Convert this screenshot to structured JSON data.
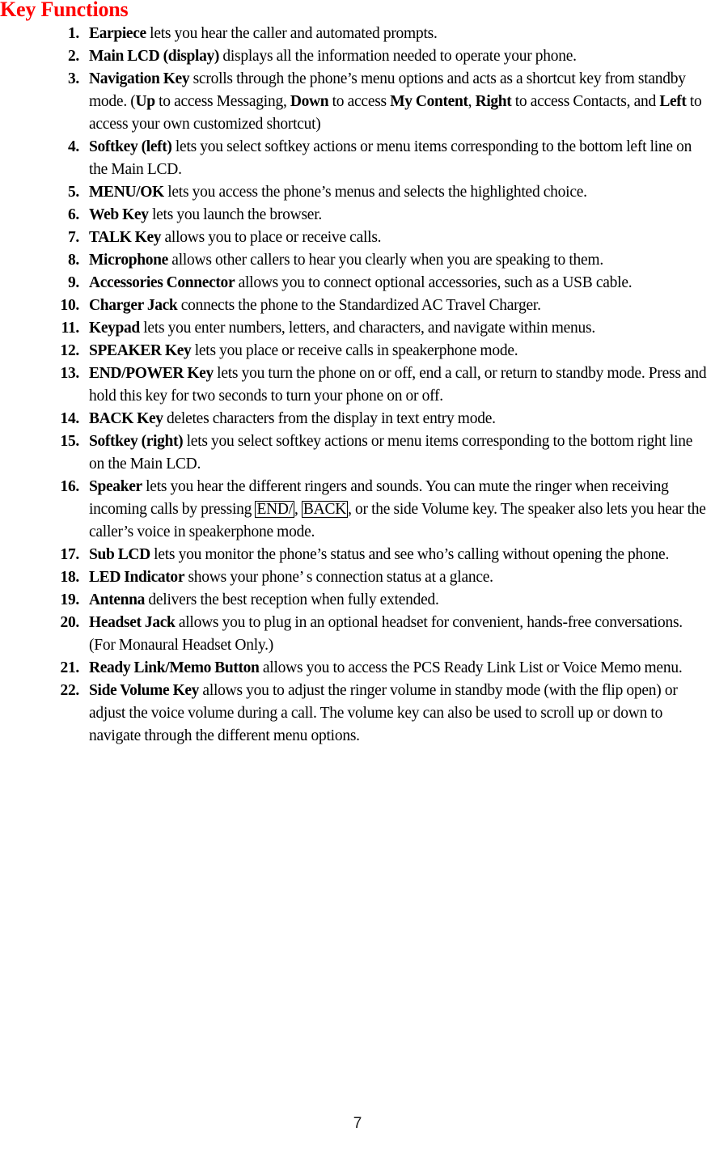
{
  "document": {
    "title": "Key Functions",
    "title_color": "#FF0000",
    "page_number": "7"
  },
  "items": [
    {
      "number": "1.",
      "term": "Earpiece",
      "text": " lets you hear the caller and automated prompts."
    },
    {
      "number": "2.",
      "term": "Main LCD (display)",
      "text": " displays all the information needed to operate your phone."
    },
    {
      "number": "3.",
      "term": "Navigation Key",
      "text": " scrolls through the phone’s menu options and acts as a shortcut key from standby mode. (",
      "runs": [
        {
          "style": "bold",
          "text": "Up"
        },
        {
          "style": "normal",
          "text": " to access Messaging, "
        },
        {
          "style": "bold",
          "text": "Down"
        },
        {
          "style": "normal",
          "text": " to access "
        },
        {
          "style": "bold",
          "text": "My Content"
        },
        {
          "style": "normal",
          "text": ", "
        },
        {
          "style": "bold",
          "text": "Right"
        },
        {
          "style": "normal",
          "text": " to access Contacts, and "
        },
        {
          "style": "bold",
          "text": "Left"
        },
        {
          "style": "normal",
          "text": " to access your own customized shortcut)"
        }
      ]
    },
    {
      "number": "4.",
      "term": "Softkey (left)",
      "text": " lets you select softkey actions or menu items corresponding to the bottom left line on the Main LCD."
    },
    {
      "number": "5.",
      "term": "MENU/OK",
      "text": " lets you access the phone’s menus and selects the highlighted choice."
    },
    {
      "number": "6.",
      "term": "Web Key",
      "text": " lets you launch the browser."
    },
    {
      "number": "7.",
      "term": "TALK Key",
      "text": " allows you to place or receive calls."
    },
    {
      "number": "8.",
      "term": "Microphone",
      "text": " allows other callers to hear you clearly when you are speaking to them."
    },
    {
      "number": "9.",
      "term": "Accessories Connector",
      "text": " allows you to connect optional accessories, such as a USB cable."
    },
    {
      "number": "10.",
      "term": "Charger Jack",
      "text": " connects the phone to the Standardized AC Travel Charger."
    },
    {
      "number": "11.",
      "term": "Keypad",
      "text": " lets you enter numbers, letters, and characters, and navigate within menus."
    },
    {
      "number": "12.",
      "term": "SPEAKER Key",
      "text": " lets you place or receive calls in speakerphone mode."
    },
    {
      "number": "13.",
      "term": "END/POWER Key",
      "text": " lets you turn the phone on or off, end a call, or return to standby mode. Press and hold this key for two seconds to turn your phone on or off."
    },
    {
      "number": "14.",
      "term": "BACK Key",
      "text": " deletes characters from the display in text entry mode."
    },
    {
      "number": "15.",
      "term": "Softkey (right)",
      "text": " lets you select softkey actions or menu items corresponding to the bottom right line on the Main LCD."
    },
    {
      "number": "16.",
      "term": "Speaker",
      "text": " lets you hear the different ringers and sounds. You can mute the ringer when receiving incoming calls by pressing ",
      "runs": [
        {
          "style": "box",
          "text": "END/"
        },
        {
          "style": "normal",
          "text": ", "
        },
        {
          "style": "box",
          "text": "BACK"
        },
        {
          "style": "normal",
          "text": ", or the side Volume key. The speaker also lets you hear the caller’s voice in speakerphone mode."
        }
      ]
    },
    {
      "number": "17.",
      "term": "Sub LCD",
      "text": " lets you monitor the phone’s status and see who’s calling without opening the phone."
    },
    {
      "number": "18.",
      "term": "LED Indicator",
      "text": " shows your phone’ s connection status at a glance."
    },
    {
      "number": "19.",
      "term": "Antenna",
      "text": " delivers the best reception when fully extended."
    },
    {
      "number": "20.",
      "term": "Headset Jack",
      "text": " allows you to plug in an optional headset for convenient, hands-free conversations. (For Monaural Headset Only.)"
    },
    {
      "number": "21.",
      "term": "Ready Link/Memo Button",
      "text": " allows you to access the PCS Ready Link List or Voice Memo menu."
    },
    {
      "number": "22.",
      "term": "Side Volume Key",
      "text": " allows you to adjust the ringer volume in standby mode (with the flip open) or adjust the voice volume during a call. The volume key can also be used to scroll up or down to navigate through the different menu options."
    }
  ]
}
